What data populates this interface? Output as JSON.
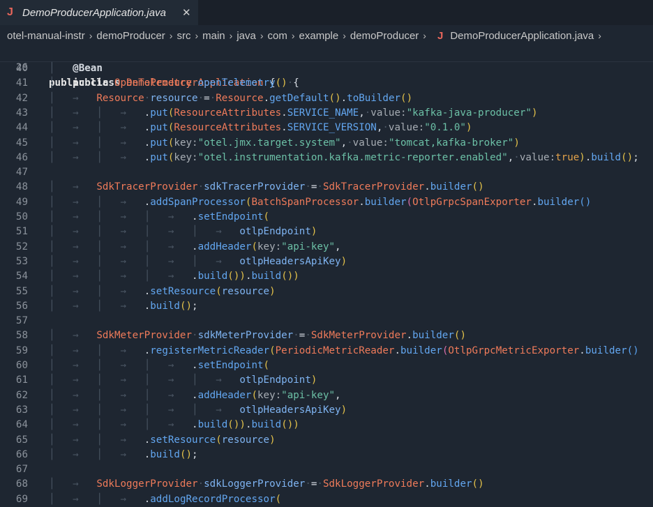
{
  "tab": {
    "title": "DemoProducerApplication.java",
    "icon": "java-file-icon",
    "close": "✕"
  },
  "breadcrumb": {
    "items": [
      "otel-manual-instr",
      "demoProducer",
      "src",
      "main",
      "java",
      "com",
      "example",
      "demoProducer"
    ],
    "file": "DemoProducerApplication.java",
    "trailing": "›"
  },
  "sticky": {
    "number": "26",
    "text": "public class DemoProducerApplication {"
  },
  "lines": [
    {
      "n": "40",
      "t": "    @Bean"
    },
    {
      "n": "41",
      "t": "    public OpenTelemetry openTelemetry() {"
    },
    {
      "n": "42",
      "t": "        Resource resource = Resource.getDefault().toBuilder()"
    },
    {
      "n": "43",
      "t": "                .put(ResourceAttributes.SERVICE_NAME, value:\"kafka-java-producer\")"
    },
    {
      "n": "44",
      "t": "                .put(ResourceAttributes.SERVICE_VERSION, value:\"0.1.0\")"
    },
    {
      "n": "45",
      "t": "                .put(key:\"otel.jmx.target.system\", value:\"tomcat,kafka-broker\")"
    },
    {
      "n": "46",
      "t": "                .put(key:\"otel.instrumentation.kafka.metric-reporter.enabled\", value:true).build();"
    },
    {
      "n": "47",
      "t": ""
    },
    {
      "n": "48",
      "t": "        SdkTracerProvider sdkTracerProvider = SdkTracerProvider.builder()"
    },
    {
      "n": "49",
      "t": "                .addSpanProcessor(BatchSpanProcessor.builder(OtlpGrpcSpanExporter.builder()"
    },
    {
      "n": "50",
      "t": "                        .setEndpoint("
    },
    {
      "n": "51",
      "t": "                                otlpEndpoint)"
    },
    {
      "n": "52",
      "t": "                        .addHeader(key:\"api-key\","
    },
    {
      "n": "53",
      "t": "                                otlpHeadersApiKey)"
    },
    {
      "n": "54",
      "t": "                        .build()).build())"
    },
    {
      "n": "55",
      "t": "                .setResource(resource)"
    },
    {
      "n": "56",
      "t": "                .build();"
    },
    {
      "n": "57",
      "t": ""
    },
    {
      "n": "58",
      "t": "        SdkMeterProvider sdkMeterProvider = SdkMeterProvider.builder()"
    },
    {
      "n": "59",
      "t": "                .registerMetricReader(PeriodicMetricReader.builder(OtlpGrpcMetricExporter.builder()"
    },
    {
      "n": "60",
      "t": "                        .setEndpoint("
    },
    {
      "n": "61",
      "t": "                                otlpEndpoint)"
    },
    {
      "n": "62",
      "t": "                        .addHeader(key:\"api-key\","
    },
    {
      "n": "63",
      "t": "                                otlpHeadersApiKey)"
    },
    {
      "n": "64",
      "t": "                        .build()).build())"
    },
    {
      "n": "65",
      "t": "                .setResource(resource)"
    },
    {
      "n": "66",
      "t": "                .build();"
    },
    {
      "n": "67",
      "t": ""
    },
    {
      "n": "68",
      "t": "        SdkLoggerProvider sdkLoggerProvider = SdkLoggerProvider.builder()"
    },
    {
      "n": "69",
      "t": "                .addLogRecordProcessor("
    }
  ]
}
